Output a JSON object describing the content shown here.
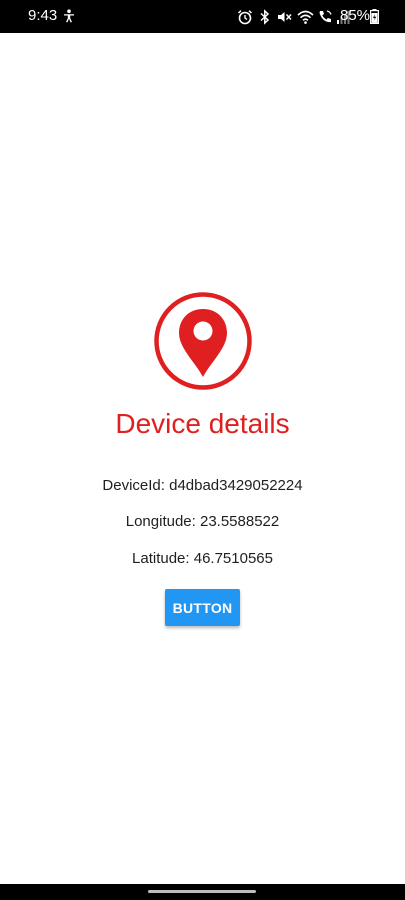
{
  "status_bar": {
    "time": "9:43",
    "battery_percent": "85%",
    "icons": [
      "accessibility-icon",
      "alarm-icon",
      "bluetooth-icon",
      "mute-icon",
      "wifi-icon",
      "wifi-calling-icon",
      "signal-icon",
      "battery-icon"
    ]
  },
  "main": {
    "title": "Device details",
    "device_id": "DeviceId: d4dbad3429052224",
    "longitude": "Longitude: 23.5588522",
    "latitude": "Latitude: 46.7510565",
    "button_label": "BUTTON"
  },
  "colors": {
    "accent": "#e02020",
    "button": "#2196f3",
    "background": "#ffffff",
    "status_bar": "#000000"
  }
}
